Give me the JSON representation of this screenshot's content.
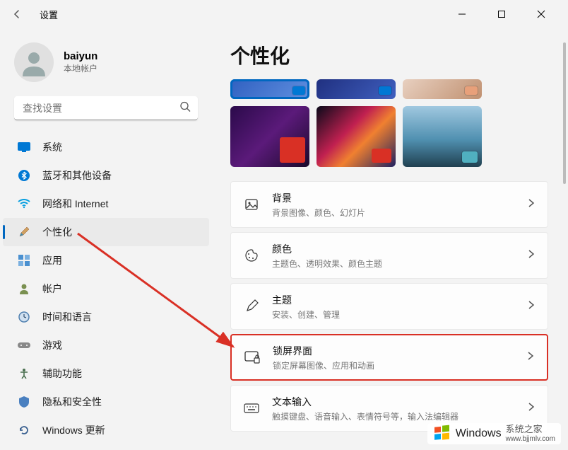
{
  "titlebar": {
    "app_title": "设置"
  },
  "user": {
    "name": "baiyun",
    "sub": "本地帐户"
  },
  "search": {
    "placeholder": "查找设置"
  },
  "nav": [
    {
      "id": "system",
      "label": "系统"
    },
    {
      "id": "bluetooth",
      "label": "蓝牙和其他设备"
    },
    {
      "id": "network",
      "label": "网络和 Internet"
    },
    {
      "id": "personalization",
      "label": "个性化"
    },
    {
      "id": "apps",
      "label": "应用"
    },
    {
      "id": "accounts",
      "label": "帐户"
    },
    {
      "id": "time",
      "label": "时间和语言"
    },
    {
      "id": "gaming",
      "label": "游戏"
    },
    {
      "id": "accessibility",
      "label": "辅助功能"
    },
    {
      "id": "privacy",
      "label": "隐私和安全性"
    },
    {
      "id": "update",
      "label": "Windows 更新"
    }
  ],
  "page": {
    "title": "个性化"
  },
  "settings": [
    {
      "id": "background",
      "title": "背景",
      "desc": "背景图像、颜色、幻灯片"
    },
    {
      "id": "colors",
      "title": "颜色",
      "desc": "主题色、透明效果、颜色主题"
    },
    {
      "id": "themes",
      "title": "主题",
      "desc": "安装、创建、管理"
    },
    {
      "id": "lockscreen",
      "title": "锁屏界面",
      "desc": "锁定屏幕图像、应用和动画"
    },
    {
      "id": "textinput",
      "title": "文本输入",
      "desc": "触摸键盘、语音输入、表情符号等，输入法编辑器"
    }
  ],
  "watermark": {
    "brand": "Windows",
    "sub1": "系统之家",
    "sub2": "www.bjjmlv.com"
  },
  "themes_row1_accents": [
    "#0078d4",
    "#0078d4",
    "#e8a07a"
  ],
  "themes_row2": [
    {
      "bg": "linear-gradient(135deg,#2a0a4a,#5b1a7a,#1a0a2a)",
      "accent": "#d93025"
    },
    {
      "bg": "linear-gradient(135deg,#0a0a1a,#c02050,#f08030,#202060)",
      "accent": "#d93025"
    },
    {
      "bg": "linear-gradient(180deg,#a0c8e0,#5090b0,#204050)",
      "accent": "#50b0c0"
    }
  ]
}
